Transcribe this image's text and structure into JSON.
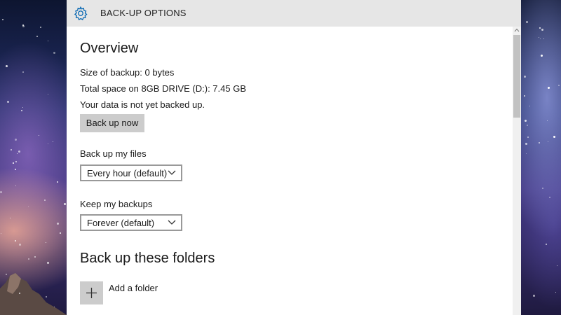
{
  "window": {
    "title": "BACK-UP OPTIONS",
    "title_icon": "gear-icon"
  },
  "overview": {
    "heading": "Overview",
    "size_of_backup": "Size of backup: 0 bytes",
    "total_space": "Total space on 8GB DRIVE (D:): 7.45 GB",
    "status": "Your data is not yet backed up.",
    "back_up_now_label": "Back up now"
  },
  "frequency": {
    "label": "Back up my files",
    "selected": "Every hour (default)"
  },
  "retention": {
    "label": "Keep my backups",
    "selected": "Forever (default)"
  },
  "folders": {
    "heading": "Back up these folders",
    "add_folder_label": "Add a folder",
    "add_folder_icon": "plus-icon"
  },
  "colors": {
    "accent": "#0063b1",
    "titlebar_bg": "#e6e6e6",
    "button_bg": "#cccccc"
  }
}
